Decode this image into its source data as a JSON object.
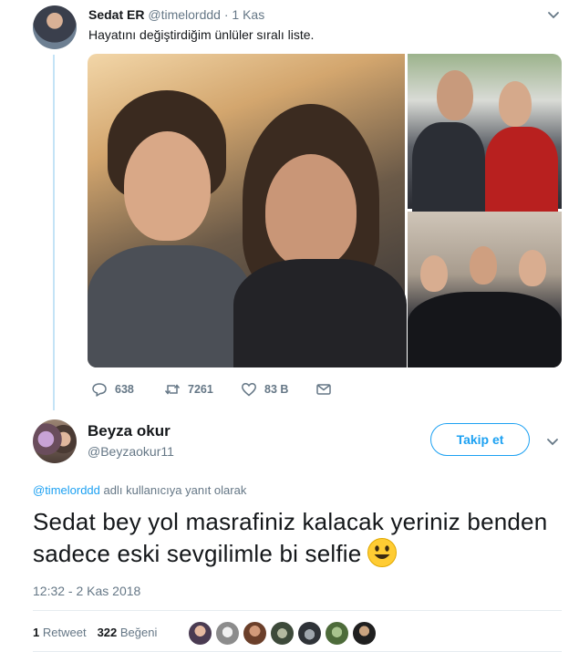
{
  "original_tweet": {
    "author_name": "Sedat ER",
    "author_handle": "@timelorddd",
    "time": "1 Kas",
    "separator": " · ",
    "text": "Hayatını değiştirdiğim ünlüler sıralı liste.",
    "actions": {
      "replies": "638",
      "retweets": "7261",
      "likes": "83 B"
    }
  },
  "reply_tweet": {
    "author_name": "Beyza okur",
    "author_handle": "@Beyzaokur11",
    "follow_label": "Takip et",
    "reply_to_mention": "@timelorddd",
    "reply_to_suffix": " adlı kullanıcıya yanıt olarak",
    "text": "Sedat bey yol masrafiniz kalacak yeriniz benden sadece eski sevgilimle bi selfie",
    "timestamp": "12:32 - 2 Kas 2018",
    "retweet_count": "1",
    "retweet_label": "Retweet",
    "like_count": "322",
    "like_label": "Beğeni"
  },
  "colors": {
    "accent": "#1da1f2",
    "text": "#14171a",
    "muted": "#657786",
    "thread_line": "#c4e3f6"
  },
  "icons": [
    "chevron-down-icon",
    "reply-icon",
    "retweet-icon",
    "heart-icon",
    "message-icon",
    "smiley-emoji-icon"
  ],
  "likers_count_shown": 7
}
